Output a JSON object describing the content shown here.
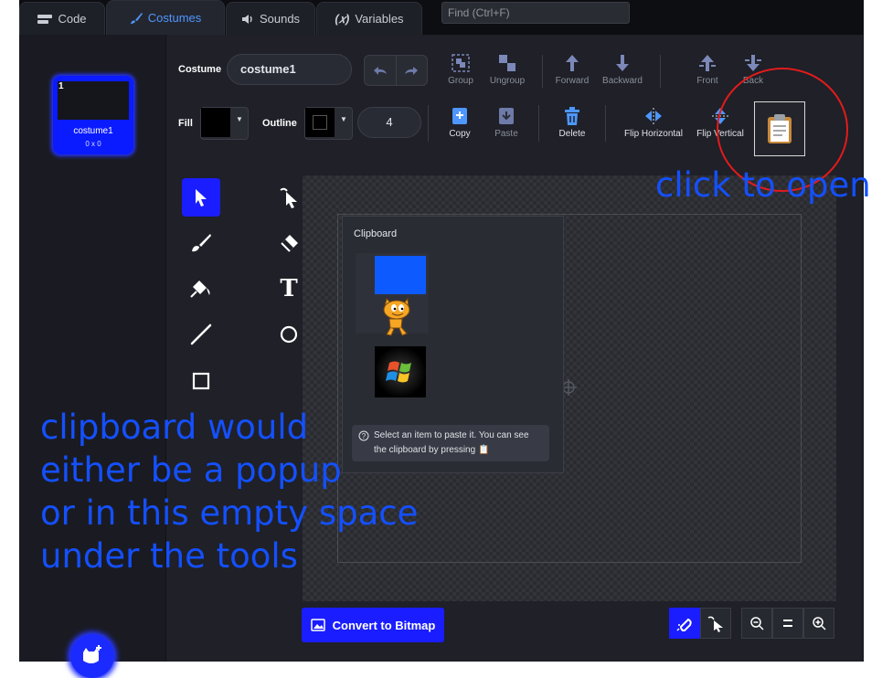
{
  "tabs": [
    {
      "label": "Code",
      "icon": "code-blocks-icon"
    },
    {
      "label": "Costumes",
      "icon": "paintbrush-icon"
    },
    {
      "label": "Sounds",
      "icon": "speaker-icon"
    },
    {
      "label": "Variables",
      "icon": "variable-x-icon"
    }
  ],
  "find": {
    "placeholder": "Find (Ctrl+F)"
  },
  "sprite": {
    "number": "1",
    "name": "costume1",
    "size": "0 x 0"
  },
  "costume": {
    "label": "Costume",
    "value": "costume1"
  },
  "fill": {
    "label": "Fill",
    "color": "#000000"
  },
  "outline": {
    "label": "Outline",
    "color": "#000000",
    "width": "4"
  },
  "toolbar": {
    "group": "Group",
    "ungroup": "Ungroup",
    "forward": "Forward",
    "backward": "Backward",
    "front": "Front",
    "back": "Back",
    "copy": "Copy",
    "paste": "Paste",
    "delete": "Delete",
    "flip_h": "Flip Horizontal",
    "flip_v": "Flip Vertical"
  },
  "clipboard_popup": {
    "title": "Clipboard",
    "items": [
      "blue-rectangle",
      "scratch-cat",
      "windows-logo"
    ],
    "note": "Select an item to paste it. You can see the clipboard by pressing"
  },
  "convert_button": "Convert to Bitmap",
  "annotations": {
    "open_hint": "click to open",
    "lines": [
      "clipboard would",
      "either be a popup",
      "or in this empty space",
      "under the tools"
    ]
  },
  "colors": {
    "accent": "#1a1dff",
    "tab_active": "#4d97ff",
    "annotation": "#1450ff",
    "circle": "#e31b1b"
  }
}
